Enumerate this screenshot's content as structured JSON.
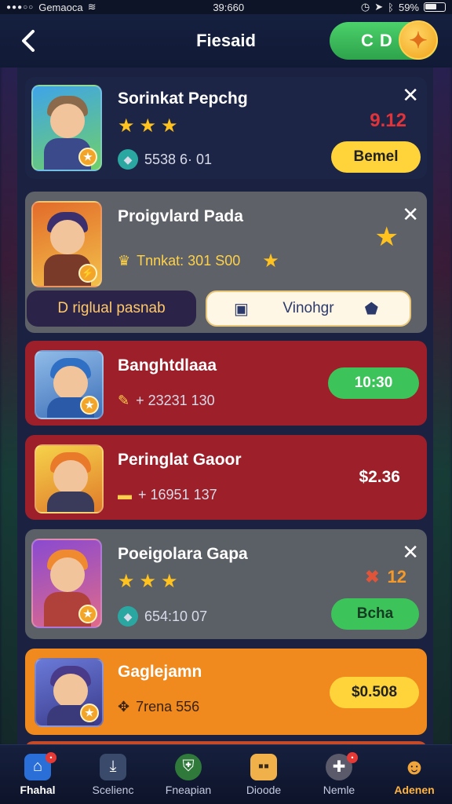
{
  "status_bar": {
    "carrier": "Gemaoca",
    "time": "39:660",
    "battery": "59%"
  },
  "header": {
    "title": "Fiesaid",
    "coin_value": "D",
    "coin_prefix": "C"
  },
  "cards": [
    {
      "title": "Sorinkat Pepchg",
      "stars": 3,
      "stat_text": "5538 6· 01",
      "price": "9.12",
      "button_label": "Bemel",
      "has_close": true
    },
    {
      "title": "Proigvlard  Pada",
      "stat_text": "Tnnkat: 301 S00",
      "left_button_label": "D riglual pasnab",
      "right_button_label": "Vinohgr",
      "has_close": true
    },
    {
      "title": "Banghtdlaaa",
      "stat_text": "+ 23231  130",
      "button_label": "10:30"
    },
    {
      "title": "Peringlat Gaoor",
      "stat_text": "+ 16951  137",
      "price": "$2.36"
    },
    {
      "title": "Poeigolara Gapa",
      "stars": 3,
      "stat_text": "654:10  07",
      "price": "12",
      "button_label": "Bcha",
      "has_close": true
    },
    {
      "title": "Gaglejamn",
      "stat_text": "7rena  556",
      "button_label": "$0.508"
    }
  ],
  "nav": [
    {
      "label": "Fhahal",
      "icon": "home-icon",
      "badge": ""
    },
    {
      "label": "Scelienc",
      "icon": "download-icon",
      "badge": ""
    },
    {
      "label": "Fneapian",
      "icon": "shield-icon",
      "badge": ""
    },
    {
      "label": "Dioode",
      "icon": "chat-icon",
      "badge": ""
    },
    {
      "label": "Nemle",
      "icon": "gamepad-icon",
      "badge": ""
    },
    {
      "label": "Adenen",
      "icon": "profile-icon",
      "badge": ""
    }
  ],
  "colors": {
    "accent_green": "#3cc35a",
    "accent_yellow": "#ffd43b",
    "card_red": "#9c1f2a",
    "card_orange": "#f08a1e"
  }
}
